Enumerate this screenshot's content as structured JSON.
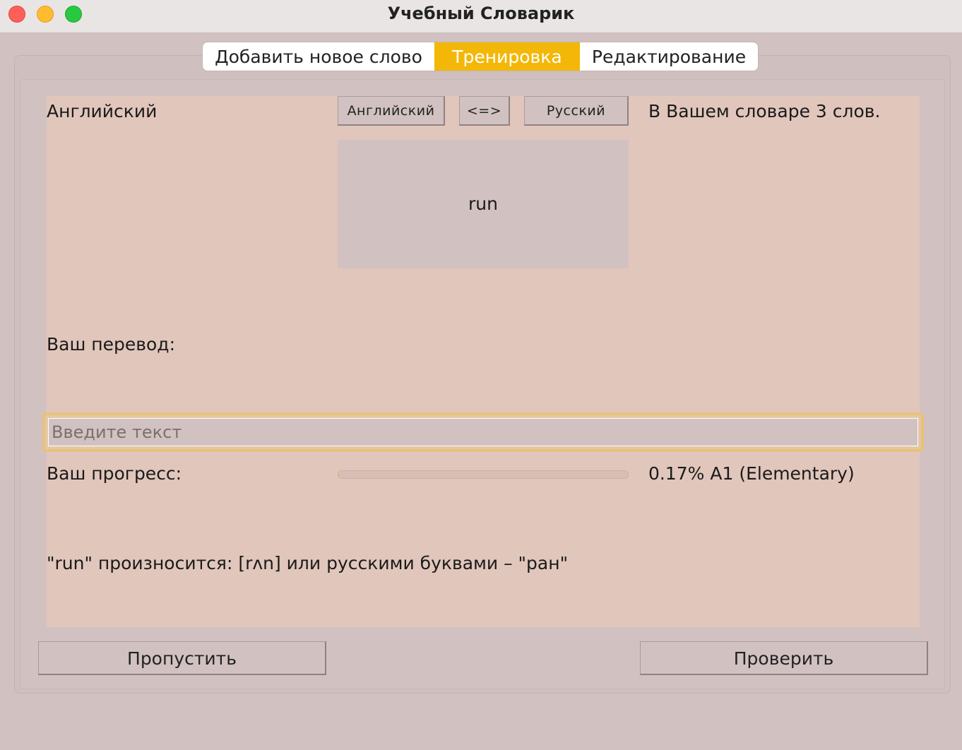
{
  "window": {
    "title": "Учебный Словарик"
  },
  "tabs": [
    {
      "label": "Добавить новое слово",
      "active": false
    },
    {
      "label": "Тренировка",
      "active": true
    },
    {
      "label": "Редактирование",
      "active": false
    }
  ],
  "training": {
    "direction_label": "Английский",
    "lang_from_button": "Английский",
    "swap_button": "<=>",
    "lang_to_button": "Русский",
    "dictionary_count": "В Вашем словаре 3 слов.",
    "current_word": "run",
    "translation_label": "Ваш перевод:",
    "translation_input": {
      "value": "",
      "placeholder": "Введите текст"
    },
    "progress_label": "Ваш прогресс:",
    "progress_value": 0.0017,
    "progress_text": "0.17% A1 (Elementary)",
    "pronunciation": "\"run\" произносится: [rʌn] или русскими буквами – \"ран\""
  },
  "actions": {
    "skip_label": "Пропустить",
    "check_label": "Проверить"
  },
  "colors": {
    "accent": "#f3b707",
    "panel_bg": "#e1c6bc",
    "window_bg": "#d1c1c1"
  }
}
